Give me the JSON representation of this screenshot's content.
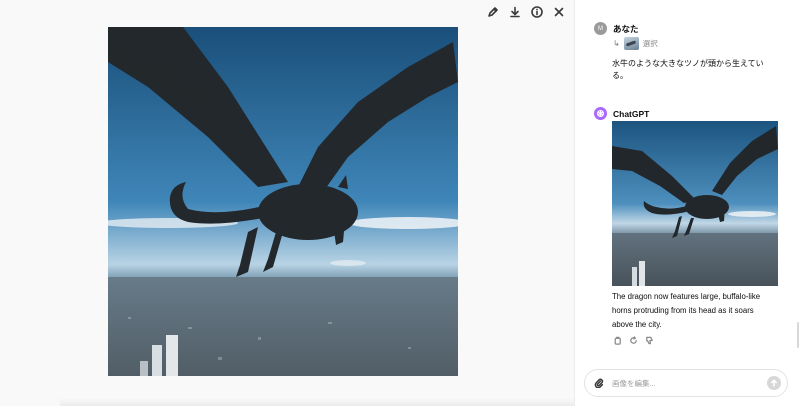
{
  "toolbar": {
    "icons": [
      "edit-icon",
      "download-icon",
      "info-icon",
      "close-icon"
    ]
  },
  "user_message": {
    "avatar_initial": "M",
    "author": "あなた",
    "selection_label": "選択",
    "text": "水牛のような大きなツノが頭から生えている。"
  },
  "assistant_message": {
    "author": "ChatGPT",
    "text": "The dragon now features large, buffalo-like horns protruding from its head as it soars above the city."
  },
  "composer": {
    "placeholder": "画像を編集..."
  },
  "colors": {
    "sky_top": "#1f5f8f",
    "sky_horizon": "#b9d2e2",
    "city": "#5d6a74",
    "dragon": "#24292d",
    "gpt_avatar": "#ab68ff"
  }
}
